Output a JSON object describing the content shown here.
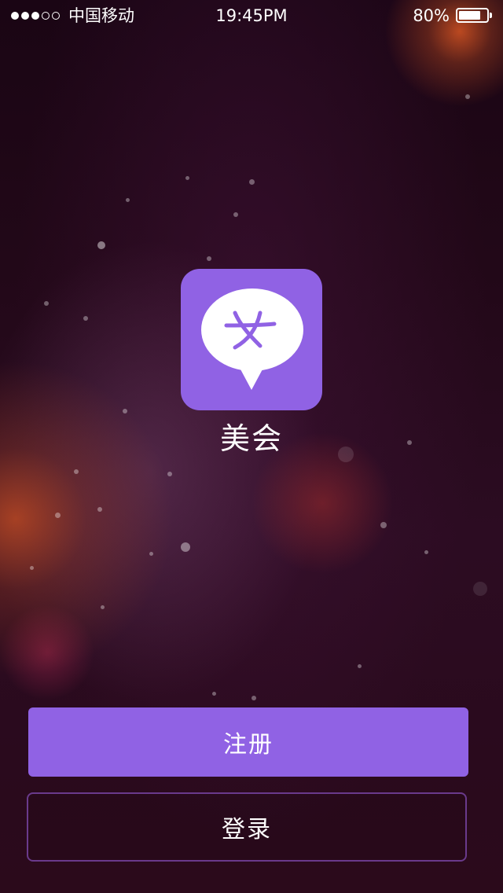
{
  "status_bar": {
    "signal": {
      "filled": 3,
      "total": 5
    },
    "carrier": "中国移动",
    "time": "19:45PM",
    "battery_percent_text": "80%",
    "battery_level": 0.8
  },
  "app": {
    "icon_name": "chat-bubble-female-icon",
    "icon_glyph": "女",
    "name": "美会",
    "accent_color": "#9062e4"
  },
  "actions": {
    "register_label": "注册",
    "login_label": "登录"
  }
}
